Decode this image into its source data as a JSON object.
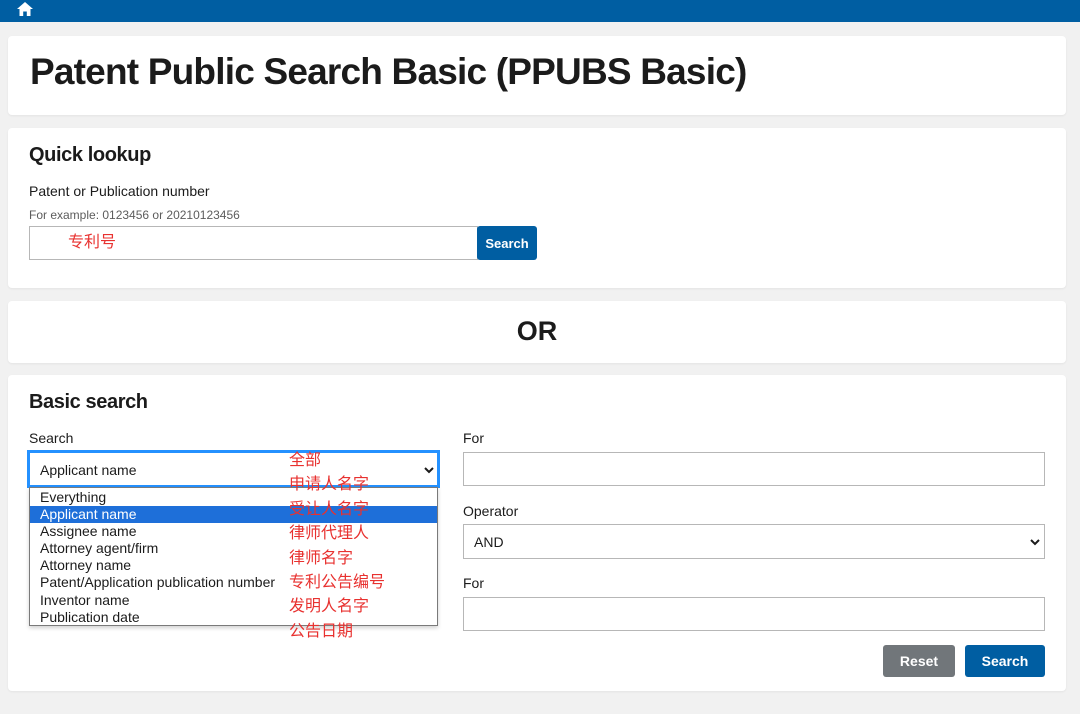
{
  "header": {
    "home_icon": "home-icon"
  },
  "title": {
    "text": "Patent Public Search Basic (PPUBS Basic)"
  },
  "quick_lookup": {
    "heading": "Quick lookup",
    "field_label": "Patent or Publication number",
    "example": "For example: 0123456 or 20210123456",
    "annotation": "专利号",
    "input_value": "",
    "search_label": "Search"
  },
  "or_divider": {
    "text": "OR"
  },
  "basic_search": {
    "heading": "Basic search",
    "search_label": "Search",
    "selected_field": "Applicant name",
    "options": [
      "Everything",
      "Applicant name",
      "Assignee name",
      "Attorney agent/firm",
      "Attorney name",
      "Patent/Application publication number",
      "Inventor name",
      "Publication date"
    ],
    "option_annotations": [
      "全部",
      "申请人名字",
      "受让人名字",
      "律师代理人",
      "律师名字",
      "专利公告编号",
      "发明人名字",
      "公告日期"
    ],
    "for_label_1": "For",
    "for_value_1": "",
    "operator_label": "Operator",
    "operator_value": "AND",
    "for_label_2": "For",
    "for_value_2": "",
    "reset_label": "Reset",
    "search_button": "Search"
  },
  "colors": {
    "brand_blue": "#005ea2",
    "focus_blue": "#2491ff",
    "selected_option": "#1e6fd9",
    "reset_gray": "#71767a",
    "annotation_red": "#e8312f"
  }
}
